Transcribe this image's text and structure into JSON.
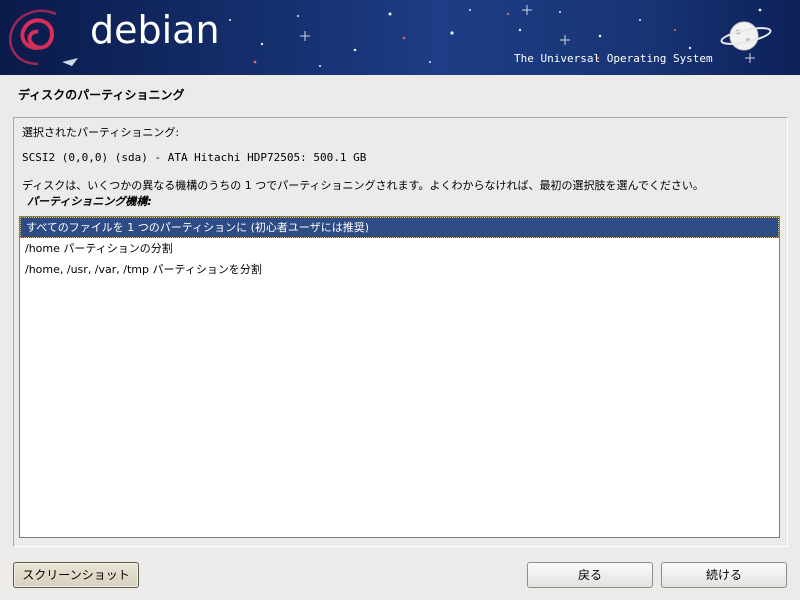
{
  "banner": {
    "logo_text": "debian",
    "tagline": "The Universal Operating System"
  },
  "page": {
    "title": "ディスクのパーティショニング"
  },
  "content": {
    "selected_label": "選択されたパーティショニング:",
    "disk_info": "SCSI2 (0,0,0) (sda) - ATA Hitachi HDP72505: 500.1 GB",
    "description": "ディスクは、いくつかの異なる機構のうちの 1 つでパーティショニングされます。よくわからなければ、最初の選択肢を選んでください。",
    "scheme_label": "パーティショニング機構:"
  },
  "options": [
    {
      "label": "すべてのファイルを 1 つのパーティションに (初心者ユーザには推奨)",
      "selected": true
    },
    {
      "label": "/home パーティションの分割",
      "selected": false
    },
    {
      "label": "/home, /usr, /var, /tmp パーティションを分割",
      "selected": false
    }
  ],
  "buttons": {
    "screenshot": "スクリーンショット",
    "back": "戻る",
    "continue": "続ける"
  },
  "colors": {
    "banner": "#16306f",
    "selection": "#2d4b84",
    "background": "#ecebe9"
  }
}
